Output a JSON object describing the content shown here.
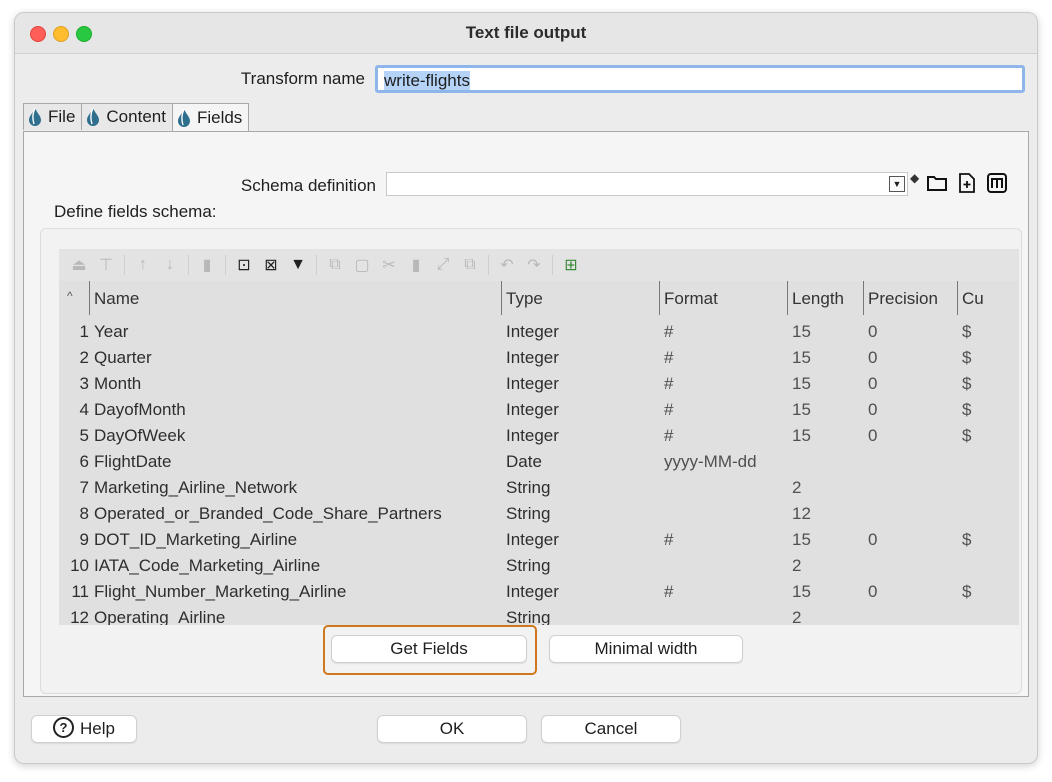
{
  "window": {
    "title": "Text file output"
  },
  "transform": {
    "label": "Transform name",
    "value": "write-flights"
  },
  "tabs": [
    {
      "label": "File"
    },
    {
      "label": "Content"
    },
    {
      "label": "Fields"
    }
  ],
  "schema": {
    "label": "Schema definition",
    "value": "",
    "define_label": "Define fields schema:"
  },
  "grid": {
    "sort_indicator": "^",
    "columns": [
      "Name",
      "Type",
      "Format",
      "Length",
      "Precision",
      "Cu"
    ],
    "rows": [
      {
        "n": "1",
        "name": "Year",
        "type": "Integer",
        "format": "#",
        "length": "15",
        "precision": "0",
        "cu": "$"
      },
      {
        "n": "2",
        "name": "Quarter",
        "type": "Integer",
        "format": "#",
        "length": "15",
        "precision": "0",
        "cu": "$"
      },
      {
        "n": "3",
        "name": "Month",
        "type": "Integer",
        "format": "#",
        "length": "15",
        "precision": "0",
        "cu": "$"
      },
      {
        "n": "4",
        "name": "DayofMonth",
        "type": "Integer",
        "format": "#",
        "length": "15",
        "precision": "0",
        "cu": "$"
      },
      {
        "n": "5",
        "name": "DayOfWeek",
        "type": "Integer",
        "format": "#",
        "length": "15",
        "precision": "0",
        "cu": "$"
      },
      {
        "n": "6",
        "name": "FlightDate",
        "type": "Date",
        "format": "yyyy-MM-dd",
        "length": "",
        "precision": "",
        "cu": ""
      },
      {
        "n": "7",
        "name": "Marketing_Airline_Network",
        "type": "String",
        "format": "",
        "length": "2",
        "precision": "",
        "cu": ""
      },
      {
        "n": "8",
        "name": "Operated_or_Branded_Code_Share_Partners",
        "type": "String",
        "format": "",
        "length": "12",
        "precision": "",
        "cu": ""
      },
      {
        "n": "9",
        "name": "DOT_ID_Marketing_Airline",
        "type": "Integer",
        "format": "#",
        "length": "15",
        "precision": "0",
        "cu": "$"
      },
      {
        "n": "10",
        "name": "IATA_Code_Marketing_Airline",
        "type": "String",
        "format": "",
        "length": "2",
        "precision": "",
        "cu": ""
      },
      {
        "n": "11",
        "name": "Flight_Number_Marketing_Airline",
        "type": "Integer",
        "format": "#",
        "length": "15",
        "precision": "0",
        "cu": "$"
      },
      {
        "n": "12",
        "name": "Operating_Airline",
        "type": "String",
        "format": "",
        "length": "2",
        "precision": "",
        "cu": ""
      }
    ]
  },
  "buttons": {
    "get_fields": "Get Fields",
    "minimal_width": "Minimal width",
    "help": "Help",
    "ok": "OK",
    "cancel": "Cancel"
  },
  "icons": {
    "tab": "hop-drop-icon",
    "schema": [
      "diamond-icon",
      "folder-icon",
      "new-file-icon",
      "metadata-icon"
    ],
    "toolbar": [
      "insert-before-icon",
      "insert-after-icon",
      "move-up-icon",
      "move-down-icon",
      "delete-icon",
      "select-all-icon",
      "clear-selection-icon",
      "filter-icon",
      "copy-icon",
      "paste-icon",
      "cut-icon",
      "delete-rows-icon",
      "expand-icon",
      "duplicate-icon",
      "undo-icon",
      "redo-icon",
      "excel-icon"
    ]
  },
  "colors": {
    "accent": "#d0781f",
    "selection": "#b4d3f7"
  }
}
